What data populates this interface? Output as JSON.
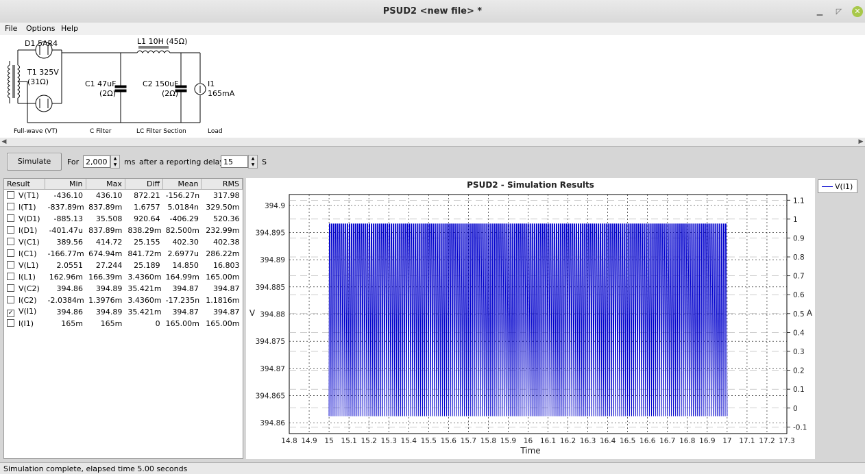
{
  "window": {
    "title": "PSUD2  <new file> *"
  },
  "menu": {
    "file": "File",
    "options": "Options",
    "help": "Help"
  },
  "schematic": {
    "rectifier_label": "D1 5AR4",
    "transformer_label": "T1 325V",
    "transformer_res": "(31Ω)",
    "inductor_label": "L1 10H (45Ω)",
    "c1_label": "C1 47uF",
    "c1_res": "(2Ω)",
    "c2_label": "C2 150uF",
    "c2_res": "(2Ω)",
    "load_label": "I1",
    "load_value": "165mA",
    "section_rectifier": "Full-wave (VT)",
    "section_cfilter": "C Filter",
    "section_lc": "LC Filter Section",
    "section_load": "Load"
  },
  "controls": {
    "simulate_label": "Simulate",
    "for_label": "For",
    "duration_value": "2,000",
    "ms_label": "ms",
    "after_label": "after a reporting delay of",
    "delay_value": "15",
    "s_label": "S"
  },
  "results": {
    "headers": [
      "Result",
      "Min",
      "Max",
      "Diff",
      "Mean",
      "RMS"
    ],
    "rows": [
      {
        "name": "V(T1)",
        "checked": false,
        "min": "-436.10",
        "max": "436.10",
        "diff": "872.21",
        "mean": "-156.27n",
        "rms": "317.98"
      },
      {
        "name": "I(T1)",
        "checked": false,
        "min": "-837.89m",
        "max": "837.89m",
        "diff": "1.6757",
        "mean": "5.0184n",
        "rms": "329.50m"
      },
      {
        "name": "V(D1)",
        "checked": false,
        "min": "-885.13",
        "max": "35.508",
        "diff": "920.64",
        "mean": "-406.29",
        "rms": "520.36"
      },
      {
        "name": "I(D1)",
        "checked": false,
        "min": "-401.47u",
        "max": "837.89m",
        "diff": "838.29m",
        "mean": "82.500m",
        "rms": "232.99m"
      },
      {
        "name": "V(C1)",
        "checked": false,
        "min": "389.56",
        "max": "414.72",
        "diff": "25.155",
        "mean": "402.30",
        "rms": "402.38"
      },
      {
        "name": "I(C1)",
        "checked": false,
        "min": "-166.77m",
        "max": "674.94m",
        "diff": "841.72m",
        "mean": "2.6977u",
        "rms": "286.22m"
      },
      {
        "name": "V(L1)",
        "checked": false,
        "min": "2.0551",
        "max": "27.244",
        "diff": "25.189",
        "mean": "14.850",
        "rms": "16.803"
      },
      {
        "name": "I(L1)",
        "checked": false,
        "min": "162.96m",
        "max": "166.39m",
        "diff": "3.4360m",
        "mean": "164.99m",
        "rms": "165.00m"
      },
      {
        "name": "V(C2)",
        "checked": false,
        "min": "394.86",
        "max": "394.89",
        "diff": "35.421m",
        "mean": "394.87",
        "rms": "394.87"
      },
      {
        "name": "I(C2)",
        "checked": false,
        "min": "-2.0384m",
        "max": "1.3976m",
        "diff": "3.4360m",
        "mean": "-17.235n",
        "rms": "1.1816m"
      },
      {
        "name": "V(I1)",
        "checked": true,
        "min": "394.86",
        "max": "394.89",
        "diff": "35.421m",
        "mean": "394.87",
        "rms": "394.87"
      },
      {
        "name": "I(I1)",
        "checked": false,
        "min": "165m",
        "max": "165m",
        "diff": "0",
        "mean": "165.00m",
        "rms": "165.00m"
      }
    ]
  },
  "chart_data": {
    "type": "line",
    "title": "PSUD2 - Simulation Results",
    "xlabel": "Time",
    "ylabel": "V",
    "y2label": "A",
    "xlim": [
      14.8,
      17.3
    ],
    "ylim": [
      394.858,
      394.902
    ],
    "y2lim": [
      -0.135,
      1.13
    ],
    "grid": true,
    "legend_position": "outside-right",
    "xticks": [
      "14.8",
      "14.9",
      "15",
      "15.1",
      "15.2",
      "15.3",
      "15.4",
      "15.5",
      "15.6",
      "15.7",
      "15.8",
      "15.9",
      "16",
      "16.1",
      "16.2",
      "16.3",
      "16.4",
      "16.5",
      "16.6",
      "16.7",
      "16.8",
      "16.9",
      "17",
      "17.1",
      "17.2",
      "17.3"
    ],
    "yticks": [
      "394.86",
      "394.865",
      "394.87",
      "394.875",
      "394.88",
      "394.885",
      "394.89",
      "394.895",
      "394.9"
    ],
    "y2ticks": [
      "-0.1",
      "0",
      "0.1",
      "0.2",
      "0.3",
      "0.4",
      "0.5",
      "0.6",
      "0.7",
      "0.8",
      "0.9",
      "1",
      "1.1"
    ],
    "series": [
      {
        "name": "V(I1)",
        "color": "#0000cc",
        "x_start": 15,
        "x_end": 17,
        "y_min": 394.8612,
        "y_max": 394.8966,
        "cycle_period": 0.01
      }
    ]
  },
  "status": {
    "text": "Simulation complete, elapsed time 5.00 seconds"
  }
}
